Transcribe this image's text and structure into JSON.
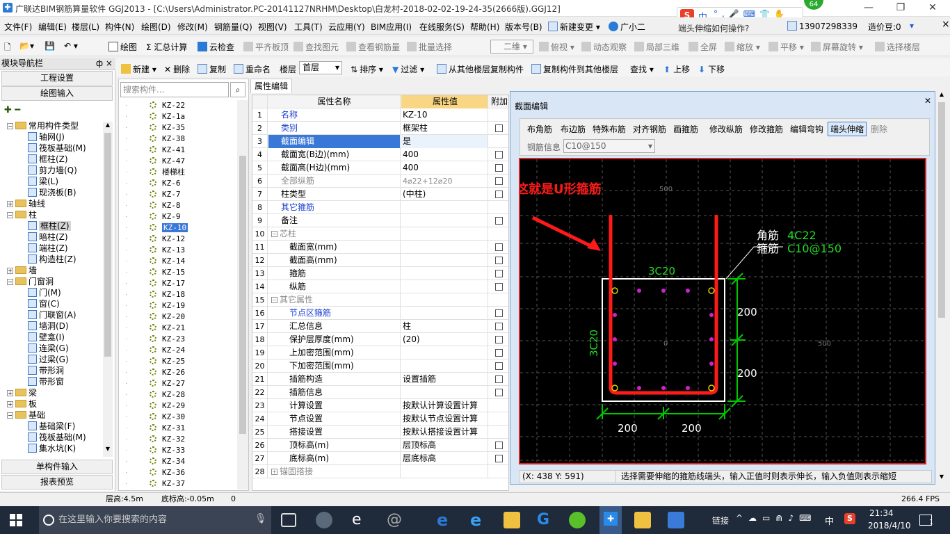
{
  "window": {
    "title": "广联达BIM钢筋算量软件 GGJ2013 - [C:\\Users\\Administrator.PC-20141127NRHM\\Desktop\\白龙村-2018-02-02-19-24-35(2666版).GGJ12]",
    "controls": {
      "minimize": "—",
      "maximize": "❐",
      "close": "✕"
    }
  },
  "ime": {
    "label": "中",
    "badge": "64"
  },
  "menu": {
    "items": [
      "文件(F)",
      "编辑(E)",
      "楼层(L)",
      "构件(N)",
      "绘图(D)",
      "修改(M)",
      "钢筋量(Q)",
      "视图(V)",
      "工具(T)",
      "云应用(Y)",
      "BIM应用(I)",
      "在线服务(S)",
      "帮助(H)",
      "版本号(B)",
      "新建变更 ▾",
      "广小二"
    ],
    "right_question": "端头伸缩如何操作?",
    "phone": "13907298339",
    "cost": "造价豆:0"
  },
  "toolbar1": {
    "items": [
      "绘图",
      "Σ 汇总计算",
      "云检查",
      "平齐板顶",
      "查找图元",
      "查看钢筋量",
      "批量选择",
      "二维",
      "俯视",
      "动态观察",
      "局部三维",
      "全屏",
      "缩放",
      "平移",
      "屏幕旋转",
      "选择楼层"
    ]
  },
  "toolbar2": {
    "items": [
      "新建",
      "删除",
      "复制",
      "重命名",
      "楼层",
      "首层",
      "排序",
      "过滤",
      "从其他楼层复制构件",
      "复制构件到其他楼层",
      "查找",
      "上移",
      "下移"
    ]
  },
  "left_panel": {
    "header": "模块导航栏",
    "pin": "ф ×",
    "btn_engineering": "工程设置",
    "btn_drawing": "绘图输入",
    "btn_single": "单构件输入",
    "btn_report": "报表预览",
    "tree": [
      {
        "label": "常用构件类型",
        "level": 0,
        "expanded": true,
        "folder": true
      },
      {
        "label": "轴网(J)",
        "level": 1
      },
      {
        "label": "筏板基础(M)",
        "level": 1
      },
      {
        "label": "框柱(Z)",
        "level": 1
      },
      {
        "label": "剪力墙(Q)",
        "level": 1
      },
      {
        "label": "梁(L)",
        "level": 1
      },
      {
        "label": "现浇板(B)",
        "level": 1
      },
      {
        "label": "轴线",
        "level": 0,
        "expanded": false,
        "folder": true
      },
      {
        "label": "柱",
        "level": 0,
        "expanded": true,
        "folder": true
      },
      {
        "label": "框柱(Z)",
        "level": 1,
        "selected": true
      },
      {
        "label": "暗柱(Z)",
        "level": 1
      },
      {
        "label": "端柱(Z)",
        "level": 1
      },
      {
        "label": "构造柱(Z)",
        "level": 1
      },
      {
        "label": "墙",
        "level": 0,
        "expanded": false,
        "folder": true
      },
      {
        "label": "门窗洞",
        "level": 0,
        "expanded": true,
        "folder": true
      },
      {
        "label": "门(M)",
        "level": 1
      },
      {
        "label": "窗(C)",
        "level": 1
      },
      {
        "label": "门联窗(A)",
        "level": 1
      },
      {
        "label": "墙洞(D)",
        "level": 1
      },
      {
        "label": "壁龛(I)",
        "level": 1
      },
      {
        "label": "连梁(G)",
        "level": 1
      },
      {
        "label": "过梁(G)",
        "level": 1
      },
      {
        "label": "带形洞",
        "level": 1
      },
      {
        "label": "带形窗",
        "level": 1
      },
      {
        "label": "梁",
        "level": 0,
        "expanded": false,
        "folder": true
      },
      {
        "label": "板",
        "level": 0,
        "expanded": false,
        "folder": true
      },
      {
        "label": "基础",
        "level": 0,
        "expanded": true,
        "folder": true
      },
      {
        "label": "基础梁(F)",
        "level": 1
      },
      {
        "label": "筏板基础(M)",
        "level": 1
      },
      {
        "label": "集水坑(K)",
        "level": 1
      }
    ]
  },
  "component_list": {
    "search_placeholder": "搜索构件...",
    "items": [
      "KZ-22",
      "KZ-1a",
      "KZ-35",
      "KZ-38",
      "KZ-41",
      "KZ-47",
      "楼梯柱",
      "KZ-6",
      "KZ-7",
      "KZ-8",
      "KZ-9",
      "KZ-10",
      "KZ-12",
      "KZ-13",
      "KZ-14",
      "KZ-15",
      "KZ-17",
      "KZ-18",
      "KZ-19",
      "KZ-20",
      "KZ-21",
      "KZ-23",
      "KZ-24",
      "KZ-25",
      "KZ-26",
      "KZ-27",
      "KZ-28",
      "KZ-29",
      "KZ-30",
      "KZ-31",
      "KZ-32",
      "KZ-33",
      "KZ-34",
      "KZ-36",
      "KZ-37"
    ],
    "selected": "KZ-10"
  },
  "property_tab": "属性编辑",
  "property_grid": {
    "headers": {
      "name": "属性名称",
      "value": "属性值",
      "extra": "附加"
    },
    "rows": [
      {
        "n": "1",
        "k": "名称",
        "v": "KZ-10",
        "blue": true,
        "chk": false
      },
      {
        "n": "2",
        "k": "类别",
        "v": "框架柱",
        "blue": true,
        "chk": true
      },
      {
        "n": "3",
        "k": "截面编辑",
        "v": "是",
        "sel": true,
        "chk": false
      },
      {
        "n": "4",
        "k": "截面宽(B边)(mm)",
        "v": "400",
        "chk": true
      },
      {
        "n": "5",
        "k": "截面高(H边)(mm)",
        "v": "400",
        "chk": true
      },
      {
        "n": "6",
        "k": "全部纵筋",
        "v": "4⌀22+12⌀20",
        "gray": true,
        "chk": true
      },
      {
        "n": "7",
        "k": "柱类型",
        "v": "(中柱)",
        "chk": true
      },
      {
        "n": "8",
        "k": "其它箍筋",
        "v": "",
        "blue": true,
        "chk": false
      },
      {
        "n": "9",
        "k": "备注",
        "v": "",
        "chk": true
      },
      {
        "n": "10",
        "k": "芯柱",
        "v": "",
        "gray": true,
        "exp": "−",
        "chk": false
      },
      {
        "n": "11",
        "k": "截面宽(mm)",
        "v": "",
        "indent": true,
        "chk": true
      },
      {
        "n": "12",
        "k": "截面高(mm)",
        "v": "",
        "indent": true,
        "chk": true
      },
      {
        "n": "13",
        "k": "箍筋",
        "v": "",
        "indent": true,
        "chk": true
      },
      {
        "n": "14",
        "k": "纵筋",
        "v": "",
        "indent": true,
        "chk": true
      },
      {
        "n": "15",
        "k": "其它属性",
        "v": "",
        "gray": true,
        "exp": "−",
        "chk": false
      },
      {
        "n": "16",
        "k": "节点区箍筋",
        "v": "",
        "blue": true,
        "indent": true,
        "chk": true
      },
      {
        "n": "17",
        "k": "汇总信息",
        "v": "柱",
        "indent": true,
        "chk": true
      },
      {
        "n": "18",
        "k": "保护层厚度(mm)",
        "v": "(20)",
        "indent": true,
        "chk": true
      },
      {
        "n": "19",
        "k": "上加密范围(mm)",
        "v": "",
        "indent": true,
        "chk": true
      },
      {
        "n": "20",
        "k": "下加密范围(mm)",
        "v": "",
        "indent": true,
        "chk": true
      },
      {
        "n": "21",
        "k": "插筋构造",
        "v": "设置插筋",
        "indent": true,
        "chk": true
      },
      {
        "n": "22",
        "k": "插筋信息",
        "v": "",
        "indent": true,
        "chk": true
      },
      {
        "n": "23",
        "k": "计算设置",
        "v": "按默认计算设置计算",
        "indent": true,
        "chk": false
      },
      {
        "n": "24",
        "k": "节点设置",
        "v": "按默认节点设置计算",
        "indent": true,
        "chk": false
      },
      {
        "n": "25",
        "k": "搭接设置",
        "v": "按默认搭接设置计算",
        "indent": true,
        "chk": false
      },
      {
        "n": "26",
        "k": "顶标高(m)",
        "v": "层顶标高",
        "indent": true,
        "chk": true
      },
      {
        "n": "27",
        "k": "底标高(m)",
        "v": "层底标高",
        "indent": true,
        "chk": true
      },
      {
        "n": "28",
        "k": "锚固搭接",
        "v": "",
        "gray": true,
        "exp": "+",
        "chk": false
      }
    ]
  },
  "section_dialog": {
    "title": "截面编辑",
    "close": "✕",
    "tools": [
      "布角筋",
      "布边筋",
      "特殊布筋",
      "对齐钢筋",
      "画箍筋",
      "修改纵筋",
      "修改箍筋",
      "编辑弯钩",
      "端头伸缩",
      "删除"
    ],
    "active_tool": "端头伸缩",
    "rebar_info_label": "钢筋信息",
    "rebar_info_value": "C10@150",
    "annotation_red": "这就是U形箍筋",
    "label_corner": "角筋",
    "label_corner_val": "4C22",
    "label_stirrup": "箍筋",
    "label_stirrup_val": "C10@150",
    "top_bar": "3C20",
    "side_bar": "3C20",
    "dim_200_a": "200",
    "dim_200_b": "200",
    "dim_200_c": "200",
    "dim_200_d": "200",
    "axis_top": "500",
    "axis_right": "500",
    "axis_center": "0",
    "coords": "(X: 438 Y: 591)",
    "hint": "选择需要伸缩的箍筋线端头，输入正值时则表示伸长，输入负值则表示缩短",
    "colors": {
      "stirrup": "#ff1a1a",
      "dim": "#00c800",
      "frame": "#ffffff",
      "rebar_corner": "#e0d000",
      "rebar_side": "#d020d0",
      "annotation": "#ff1a1a",
      "label_green": "#22dd22"
    }
  },
  "statusbar": {
    "floor_height": "层高:4.5m",
    "bottom_elev": "底标高:-0.05m",
    "zero": "0",
    "fps": "266.4 FPS"
  },
  "taskbar": {
    "search_placeholder": "在这里输入你要搜索的内容",
    "link": "链接",
    "lang": "中",
    "time": "21:34",
    "date": "2018/4/10",
    "notif": "1"
  }
}
